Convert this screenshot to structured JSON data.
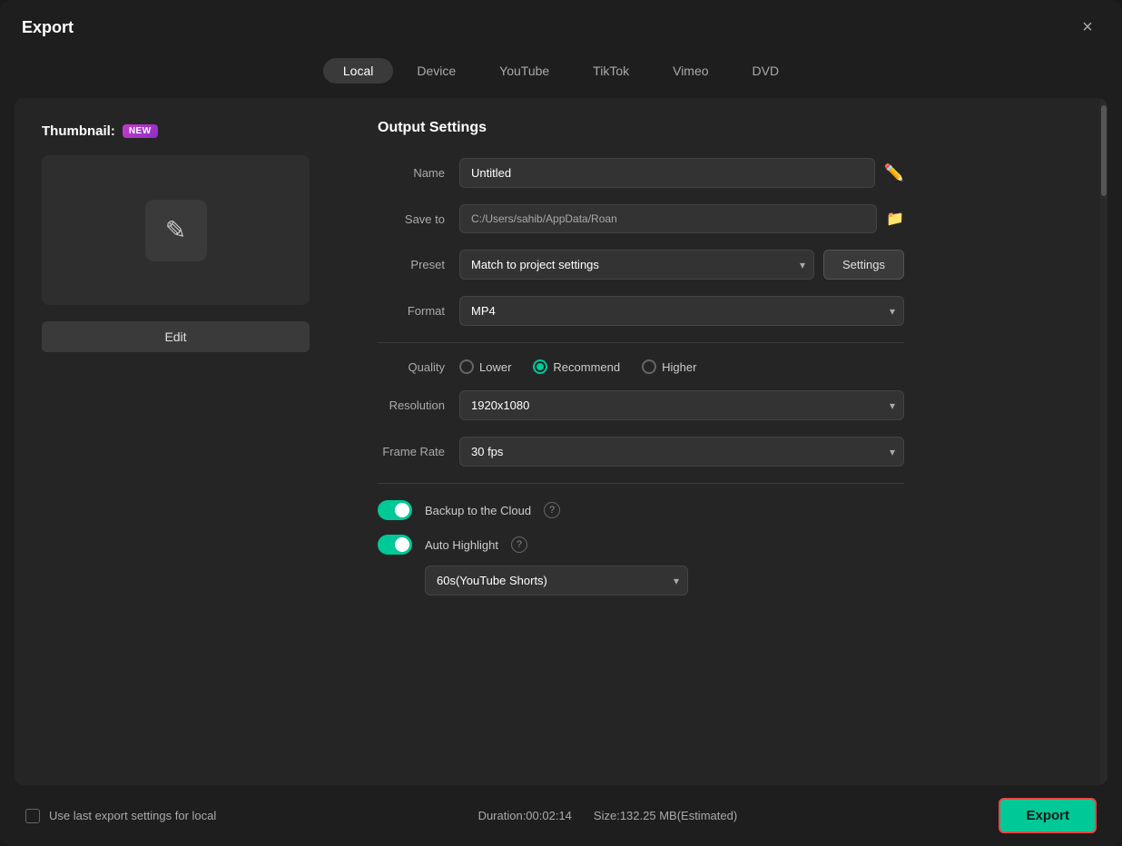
{
  "dialog": {
    "title": "Export",
    "close_label": "×"
  },
  "tabs": [
    {
      "id": "local",
      "label": "Local",
      "active": true
    },
    {
      "id": "device",
      "label": "Device",
      "active": false
    },
    {
      "id": "youtube",
      "label": "YouTube",
      "active": false
    },
    {
      "id": "tiktok",
      "label": "TikTok",
      "active": false
    },
    {
      "id": "vimeo",
      "label": "Vimeo",
      "active": false
    },
    {
      "id": "dvd",
      "label": "DVD",
      "active": false
    }
  ],
  "left_panel": {
    "thumbnail_label": "Thumbnail:",
    "new_badge": "NEW",
    "edit_label": "Edit"
  },
  "output_settings": {
    "section_title": "Output Settings",
    "name_label": "Name",
    "name_value": "Untitled",
    "save_to_label": "Save to",
    "save_to_value": "C:/Users/sahib/AppData/Roan",
    "preset_label": "Preset",
    "preset_value": "Match to project settings",
    "settings_label": "Settings",
    "format_label": "Format",
    "format_value": "MP4",
    "quality_label": "Quality",
    "quality_options": [
      {
        "id": "lower",
        "label": "Lower",
        "selected": false
      },
      {
        "id": "recommend",
        "label": "Recommend",
        "selected": true
      },
      {
        "id": "higher",
        "label": "Higher",
        "selected": false
      }
    ],
    "resolution_label": "Resolution",
    "resolution_value": "1920x1080",
    "frame_rate_label": "Frame Rate",
    "frame_rate_value": "30 fps",
    "backup_label": "Backup to the Cloud",
    "backup_on": true,
    "auto_highlight_label": "Auto Highlight",
    "auto_highlight_on": true,
    "highlight_duration_value": "60s(YouTube Shorts)"
  },
  "footer": {
    "checkbox_label": "Use last export settings for local",
    "duration_label": "Duration:00:02:14",
    "size_label": "Size:132.25 MB(Estimated)",
    "export_label": "Export"
  }
}
